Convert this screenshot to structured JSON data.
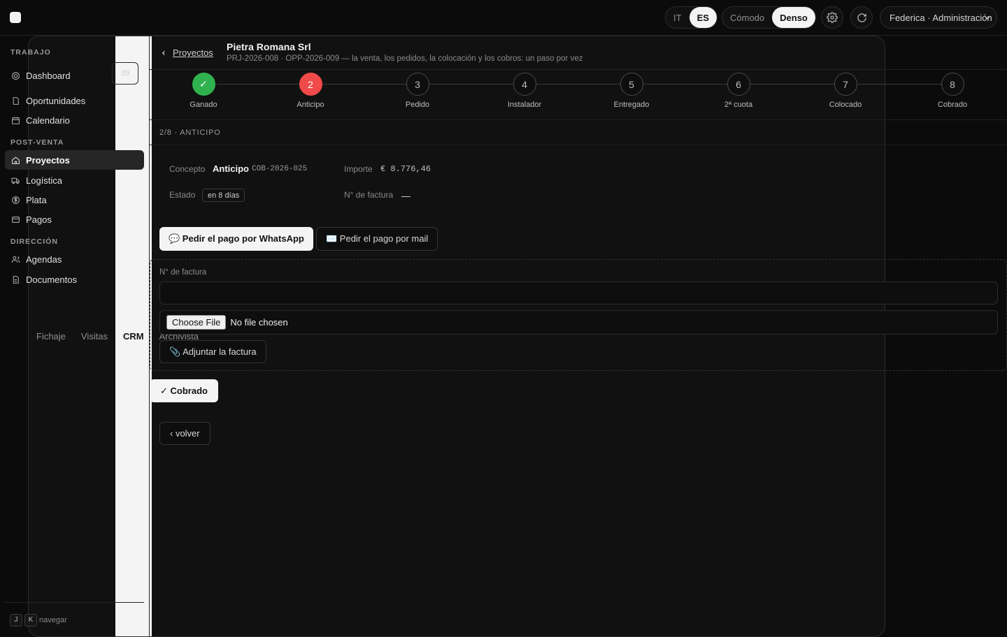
{
  "topbar": {
    "modules": [
      "Fichaje",
      "Visitas",
      "CRM",
      "Archivista"
    ],
    "active_module": "CRM",
    "languages": [
      "IT",
      "ES"
    ],
    "active_language": "ES",
    "density": [
      "Cómodo",
      "Denso"
    ],
    "active_density": "Denso",
    "user_select": "Federica · Administración"
  },
  "sidebar": {
    "section_trabajo": "TRABAJO",
    "section_postventa": "POST-VENTA",
    "section_direccion": "DIRECCIÓN",
    "items": [
      {
        "label": "Dashboard",
        "icon": "target-icon",
        "count": "39"
      },
      {
        "label": "Oportunidades",
        "icon": "file-icon"
      },
      {
        "label": "Calendario",
        "icon": "calendar-icon"
      },
      {
        "label": "Proyectos",
        "icon": "home-icon",
        "active": true
      },
      {
        "label": "Logística",
        "icon": "truck-icon"
      },
      {
        "label": "Plata",
        "icon": "dollar-icon"
      },
      {
        "label": "Pagos",
        "icon": "card-icon"
      },
      {
        "label": "Agendas",
        "icon": "users-icon"
      },
      {
        "label": "Documentos",
        "icon": "document-icon"
      }
    ],
    "footer": {
      "key1": "J",
      "key2": "K",
      "hint": "navegar"
    }
  },
  "header": {
    "back_label": "Proyectos",
    "title": "Pietra Romana Srl",
    "subtitle": "PRJ-2026-008 · OPP-2026-009 — la venta, los pedidos, la colocación y los cobros: un paso por vez"
  },
  "stepper": {
    "steps": [
      {
        "num": "✓",
        "label": "Ganado",
        "state": "done"
      },
      {
        "num": "2",
        "label": "Anticipo",
        "state": "current"
      },
      {
        "num": "3",
        "label": "Pedido",
        "state": "pending"
      },
      {
        "num": "4",
        "label": "Instalador",
        "state": "pending"
      },
      {
        "num": "5",
        "label": "Entregado",
        "state": "pending"
      },
      {
        "num": "6",
        "label": "2ª cuota",
        "state": "pending"
      },
      {
        "num": "7",
        "label": "Colocado",
        "state": "pending"
      },
      {
        "num": "8",
        "label": "Cobrado",
        "state": "pending"
      }
    ]
  },
  "detail": {
    "section_label": "2/8 · ANTICIPO",
    "concept_label": "Concepto",
    "concept_value": "Anticipo",
    "concept_code": "COB-2026-025",
    "amount_label": "Importe",
    "amount_value": "€ 8.776,46",
    "status_label": "Estado",
    "status_value": "en 8 días",
    "invoice_label": "N° de factura",
    "invoice_value": "—"
  },
  "actions": {
    "whatsapp": "💬 Pedir el pago por WhatsApp",
    "mail": "✉️ Pedir el pago por mail"
  },
  "upload": {
    "invoice_number_label": "N° de factura",
    "invoice_number_value": "",
    "file_button": "Choose File",
    "file_status": "No file chosen",
    "attach_button": "📎 Adjuntar la factura"
  },
  "confirm_button": "✓ Cobrado",
  "back_button": "‹ volver"
}
